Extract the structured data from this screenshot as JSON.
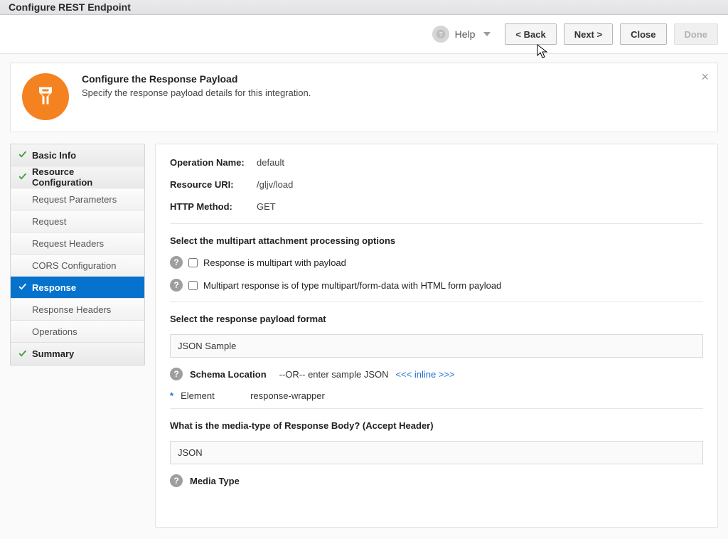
{
  "page_title": "Configure REST Endpoint",
  "toolbar": {
    "help": "Help",
    "back": "<  Back",
    "next": "Next  >",
    "close": "Close",
    "done": "Done"
  },
  "banner": {
    "title": "Configure the Response Payload",
    "desc": "Specify the response payload details for this integration."
  },
  "nav": {
    "items": [
      {
        "label": "Basic Info",
        "state": "completed"
      },
      {
        "label": "Resource Configuration",
        "state": "completed"
      },
      {
        "label": "Request Parameters",
        "state": "plain"
      },
      {
        "label": "Request",
        "state": "plain"
      },
      {
        "label": "Request Headers",
        "state": "plain"
      },
      {
        "label": "CORS Configuration",
        "state": "plain"
      },
      {
        "label": "Response",
        "state": "selected"
      },
      {
        "label": "Response Headers",
        "state": "plain"
      },
      {
        "label": "Operations",
        "state": "plain"
      },
      {
        "label": "Summary",
        "state": "completed"
      }
    ]
  },
  "main": {
    "op_name_label": "Operation Name:",
    "op_name_val": "default",
    "uri_label": "Resource URI:",
    "uri_val": "/gljv/load",
    "method_label": "HTTP Method:",
    "method_val": "GET",
    "multipart_section": "Select the multipart attachment processing options",
    "multipart_opt1": "Response is multipart with payload",
    "multipart_opt2": "Multipart response is of type multipart/form-data with HTML form payload",
    "payload_format_section": "Select the response payload format",
    "payload_format_value": "JSON Sample",
    "schema_label": "Schema Location",
    "schema_or": "--OR-- enter sample JSON",
    "schema_inline": "<<< inline >>>",
    "element_label": "Element",
    "element_val": "response-wrapper",
    "media_section": "What is the media-type of Response Body? (Accept Header)",
    "media_value": "JSON",
    "media_type_label": "Media Type"
  }
}
